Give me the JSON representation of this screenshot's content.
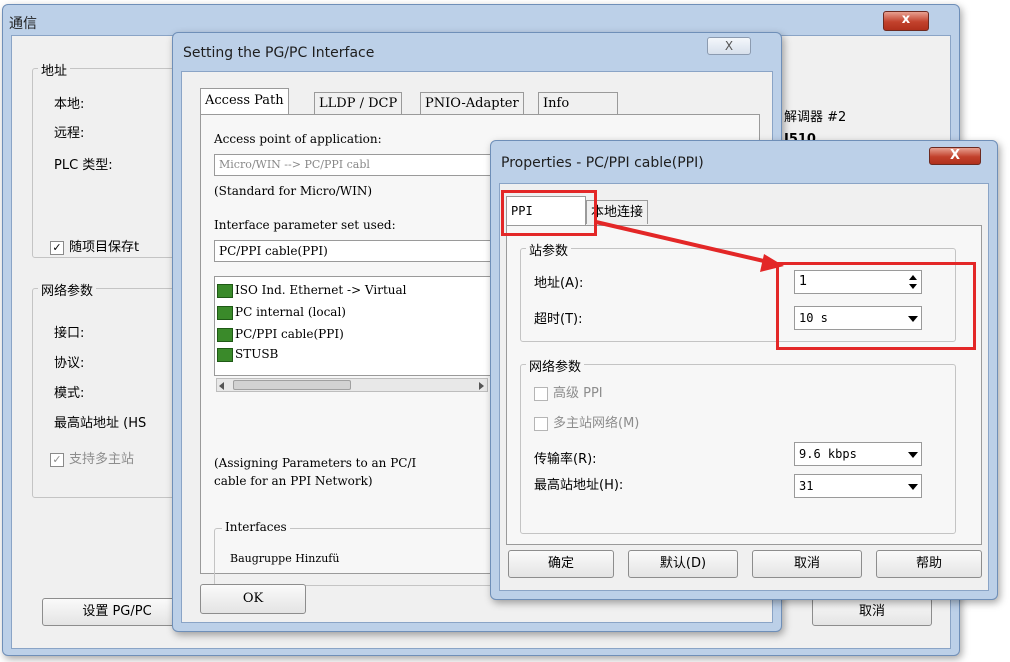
{
  "comm_window": {
    "title": "通信",
    "address_group": "地址",
    "local_label": "本地:",
    "remote_label": "远程:",
    "plc_type_label": "PLC 类型:",
    "save_with_project": "随项目保存t",
    "network_group": "网络参数",
    "interface_label": "接口:",
    "protocol_label": "协议:",
    "mode_label": "模式:",
    "highest_station_label": "最高站地址 (HS",
    "support_multimaster": "支持多主站",
    "modem_text": "解调器 #2",
    "model_text": "I510",
    "setup_button": "设置 PG/PC",
    "cancel_button": "取消"
  },
  "pgpc_window": {
    "title": "Setting the PG/PC Interface",
    "close_glyph": "X",
    "tabs": [
      "Access Path",
      "LLDP / DCP",
      "PNIO-Adapter",
      "Info"
    ],
    "access_point_label": "Access point of application:",
    "access_point_value": "Micro/WIN     --> PC/PPI cabl",
    "access_point_desc": "(Standard for Micro/WIN)",
    "param_set_label": "Interface parameter set used:",
    "param_set_value": "PC/PPI cable(PPI)",
    "param_list": [
      "ISO Ind. Ethernet -> Virtual",
      "PC internal (local)",
      "PC/PPI cable(PPI)",
      "STUSB"
    ],
    "assign_desc_1": "(Assigning Parameters to an PC/I",
    "assign_desc_2": "cable for an PPI Network)",
    "interfaces_group": "Interfaces",
    "interfaces_text": "Baugruppe Hinzufü",
    "ok_button": "OK"
  },
  "ppi_window": {
    "title": "Properties - PC/PPI cable(PPI)",
    "close_glyph": "X",
    "tab_ppi": "PPI",
    "tab_local": "本地连接",
    "station_group": "站参数",
    "address_label": "地址(A):",
    "address_value": "1",
    "timeout_label": "超时(T):",
    "timeout_value": "10 s",
    "network_group": "网络参数",
    "advanced_ppi": "高级 PPI",
    "multimaster": "多主站网络(M)",
    "baud_label": "传输率(R):",
    "baud_value": "9.6 kbps",
    "highest_label": "最高站地址(H):",
    "highest_value": "31",
    "ok_button": "确定",
    "default_button": "默认(D)",
    "cancel_button": "取消",
    "help_button": "帮助"
  },
  "colors": {
    "annotation_red": "#e32727",
    "window_frame": "#bcd0e8",
    "dialog_face": "#f0f0f0"
  }
}
